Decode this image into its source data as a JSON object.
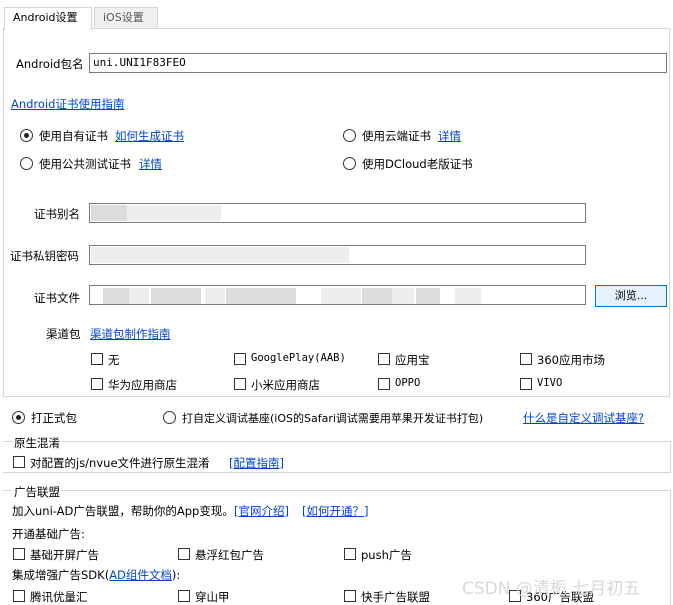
{
  "tabs": [
    "Android设置",
    "iOS设置"
  ],
  "android": {
    "package_label": "Android包名",
    "package_value": "uni.UNI1F83FEO",
    "guide_link": "Android证书使用指南",
    "cert_options": {
      "own": "使用自有证书",
      "own_link": "如何生成证书",
      "cloud": "使用云端证书",
      "cloud_link": "详情",
      "public": "使用公共测试证书",
      "public_link": "详情",
      "dcloud_old": "使用DCloud老版证书"
    },
    "alias_label": "证书别名",
    "password_label": "证书私钥密码",
    "file_label": "证书文件",
    "browse_button": "浏览...",
    "channel_label": "渠道包",
    "channel_link": "渠道包制作指南",
    "channels": [
      [
        "无",
        "GooglePlay(AAB)",
        "应用宝",
        "360应用市场"
      ],
      [
        "华为应用商店",
        "小米应用商店",
        "OPPO",
        "VIVO"
      ]
    ]
  },
  "pack_mode": {
    "formal": "打正式包",
    "custom_base": "打自定义调试基座(iOS的Safari调试需要用苹果开发证书打包)",
    "custom_base_link": "什么是自定义调试基座?"
  },
  "native_obfuscation": {
    "title": "原生混淆",
    "checkbox": "对配置的js/nvue文件进行原生混淆",
    "link": "[配置指南]"
  },
  "ad_alliance": {
    "title": "广告联盟",
    "intro": "加入uni-AD广告联盟，帮助你的App变现。",
    "link_intro": "[官网介绍]",
    "link_open": "[如何开通？]",
    "basic_label": "开通基础广告:",
    "basic_items": [
      "基础开屏广告",
      "悬浮红包广告",
      "push广告"
    ],
    "enhanced_label_prefix": "集成增强广告SDK(",
    "enhanced_label_link": "AD组件文档",
    "enhanced_label_suffix": "):",
    "enhanced_items": [
      "腾讯优量汇",
      "穿山甲",
      "快手广告联盟",
      "360广告联盟"
    ]
  },
  "watermark": "CSDN @清栀 七月初五"
}
